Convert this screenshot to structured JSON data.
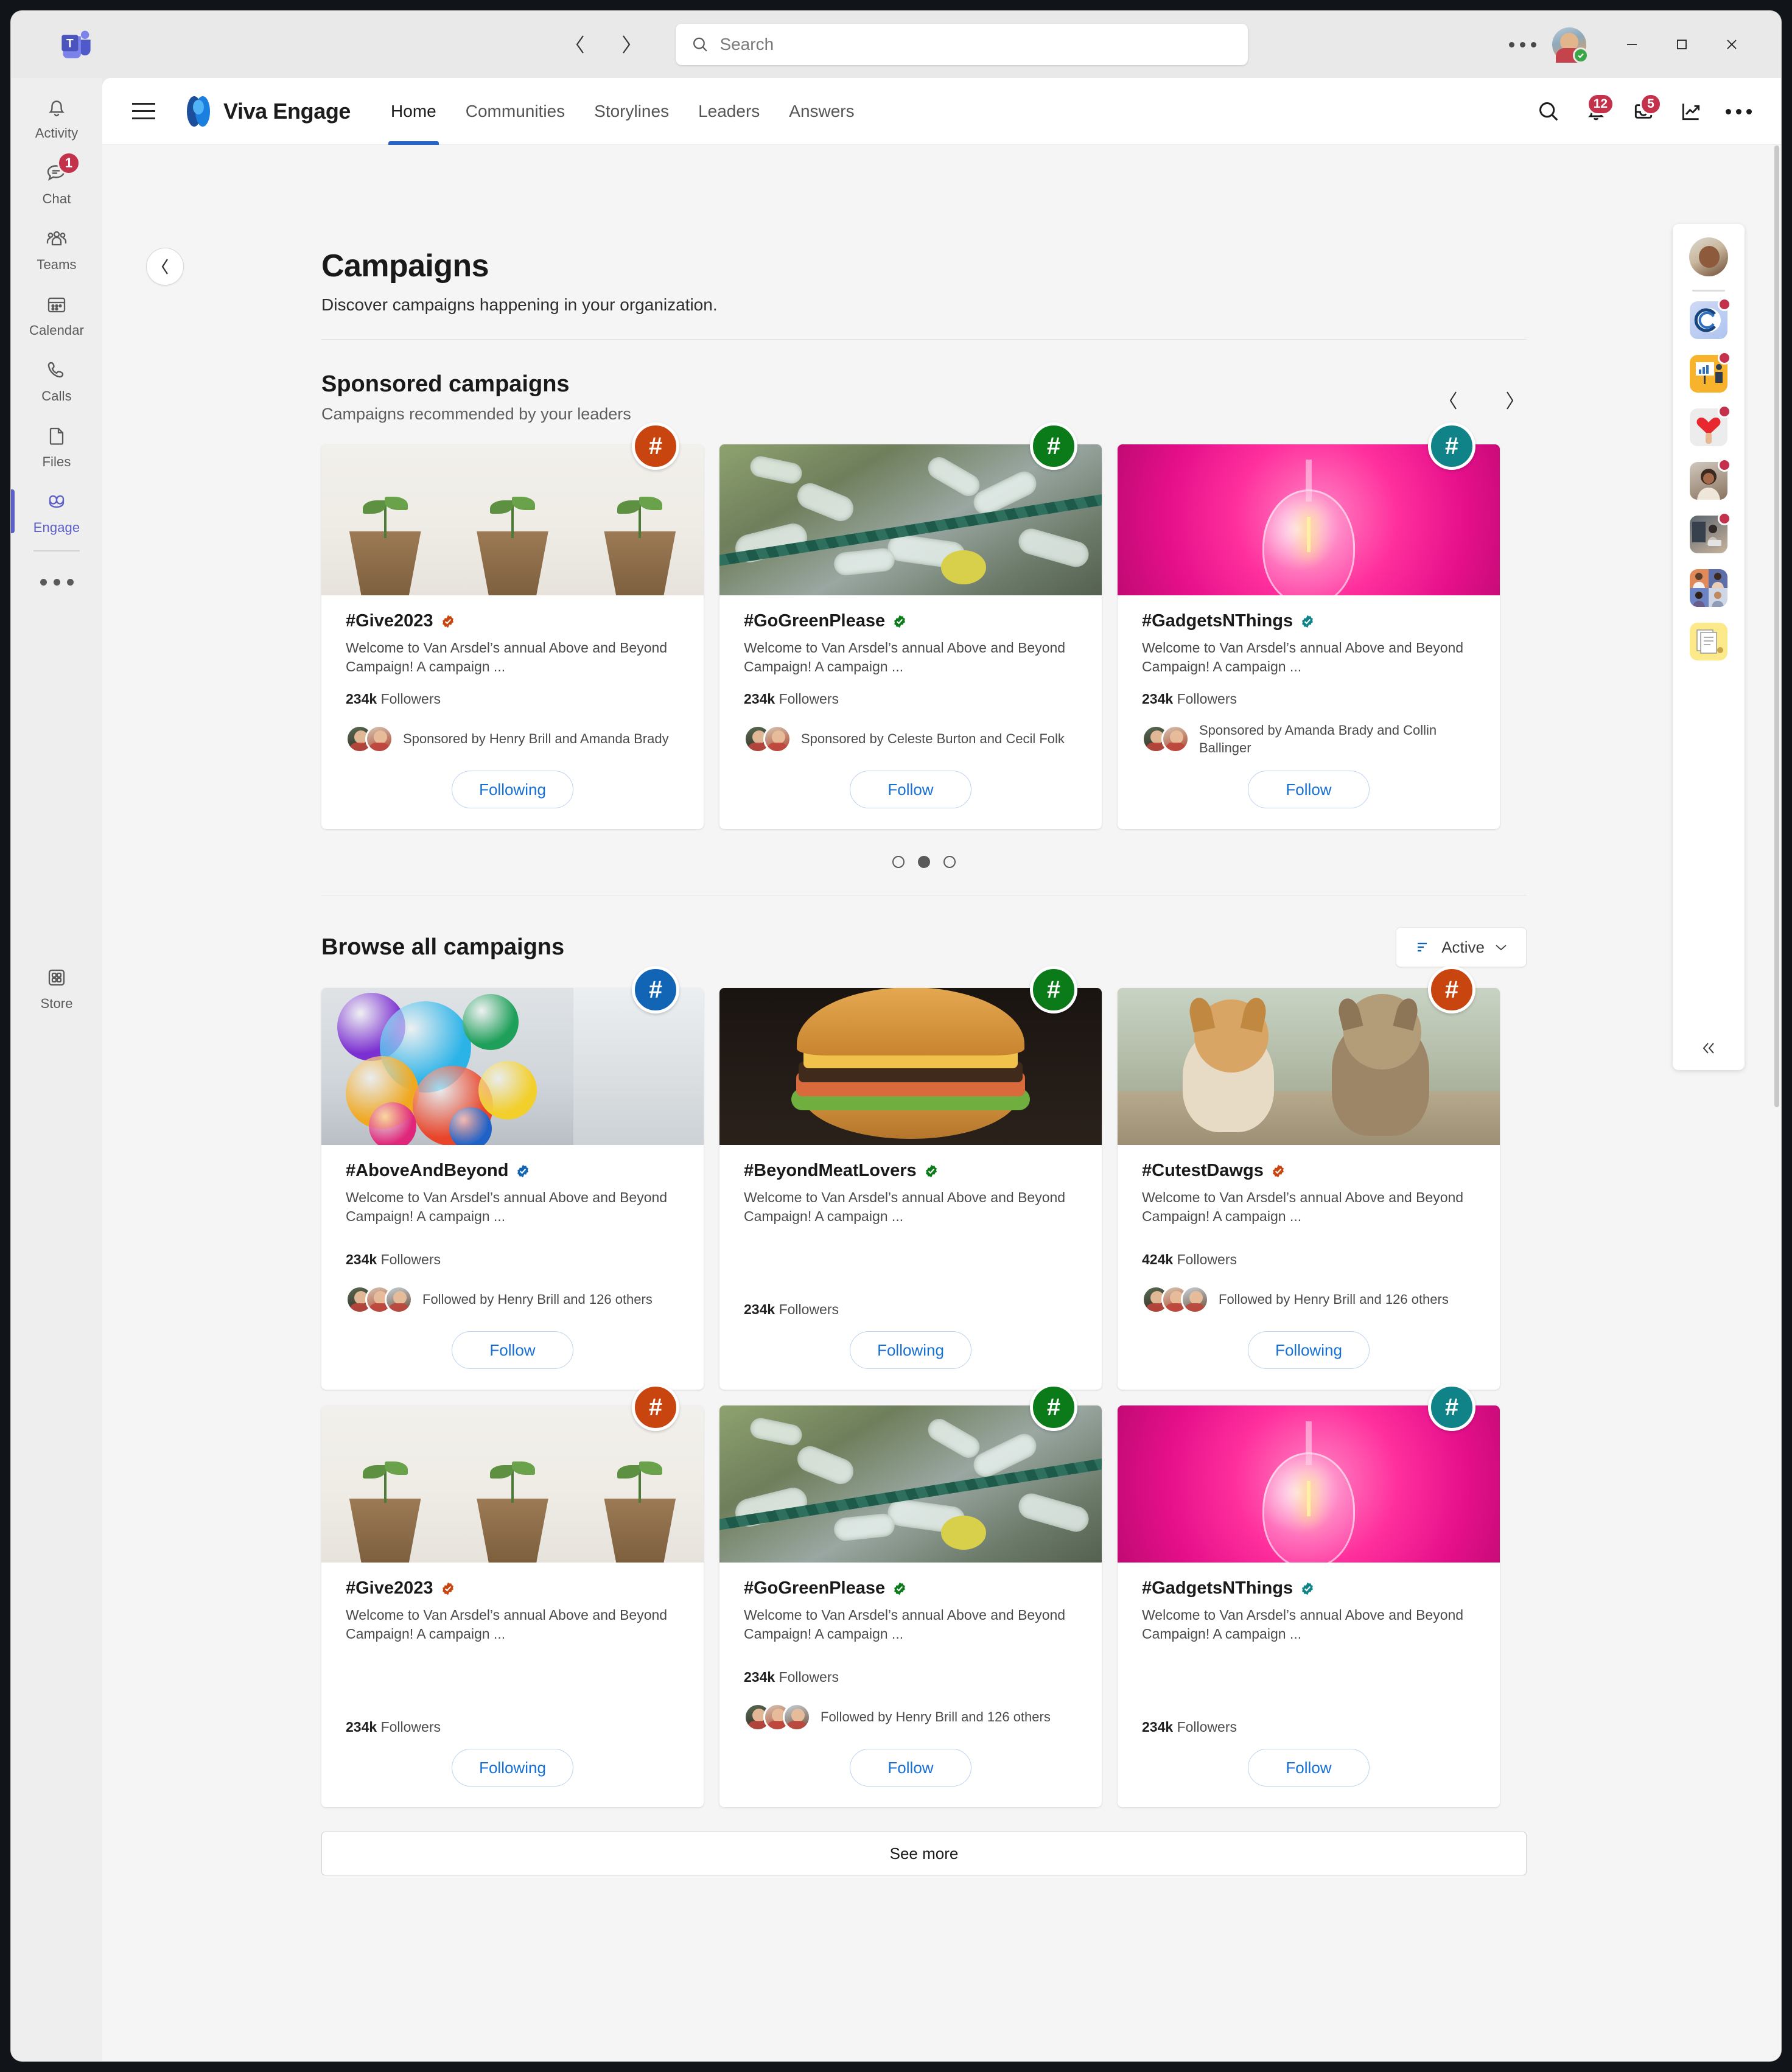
{
  "window": {
    "search_placeholder": "Search",
    "controls": {
      "more": "more-options",
      "minimize": "minimize",
      "maximize": "maximize",
      "close": "close"
    }
  },
  "rail": {
    "items": [
      {
        "label": "Activity",
        "icon": "bell-icon",
        "badge": null
      },
      {
        "label": "Chat",
        "icon": "chat-icon",
        "badge": "1"
      },
      {
        "label": "Teams",
        "icon": "teams-icon",
        "badge": null
      },
      {
        "label": "Calendar",
        "icon": "calendar-icon",
        "badge": null
      },
      {
        "label": "Calls",
        "icon": "phone-icon",
        "badge": null
      },
      {
        "label": "Files",
        "icon": "file-icon",
        "badge": null
      },
      {
        "label": "Engage",
        "icon": "engage-icon",
        "badge": null,
        "active": true
      }
    ],
    "more_label": "more-apps",
    "store": {
      "label": "Store",
      "icon": "store-icon"
    }
  },
  "header": {
    "brand": "Viva Engage",
    "nav": [
      {
        "label": "Home",
        "active": true
      },
      {
        "label": "Communities",
        "active": false
      },
      {
        "label": "Storylines",
        "active": false
      },
      {
        "label": "Leaders",
        "active": false
      },
      {
        "label": "Answers",
        "active": false
      }
    ],
    "icons": [
      {
        "name": "search-icon",
        "badge": null
      },
      {
        "name": "bell-icon",
        "badge": "12"
      },
      {
        "name": "inbox-icon",
        "badge": "5"
      },
      {
        "name": "analytics-icon",
        "badge": null
      },
      {
        "name": "more-icon",
        "badge": null
      }
    ]
  },
  "page": {
    "title": "Campaigns",
    "subtitle": "Discover campaigns happening in your organization."
  },
  "sponsored": {
    "title": "Sponsored campaigns",
    "subtitle": "Campaigns recommended by your leaders",
    "prev": "previous",
    "next": "next",
    "dots": [
      false,
      true,
      false
    ],
    "cards": [
      {
        "name": "#Give2023",
        "desc": "Welcome to Van Arsdel’s annual Above and Beyond Campaign! A campaign ...",
        "followers_count": "234k",
        "followers_label": "Followers",
        "people_text": "Sponsored by Henry Brill and Amanda Brady",
        "people_avatars": 2,
        "button": "Following",
        "accent": "#c9450f",
        "verified_color": "#c9450f",
        "image": "seedling-pots"
      },
      {
        "name": "#GoGreenPlease",
        "desc": "Welcome to Van Arsdel’s annual Above and Beyond Campaign! A campaign ...",
        "followers_count": "234k",
        "followers_label": "Followers",
        "people_text": "Sponsored by Celeste Burton and Cecil Folk",
        "people_avatars": 2,
        "button": "Follow",
        "accent": "#0b7a18",
        "verified_color": "#0b7a18",
        "image": "plastic-bottles"
      },
      {
        "name": "#GadgetsNThings",
        "desc": "Welcome to Van Arsdel’s annual Above and Beyond Campaign! A campaign ...",
        "followers_count": "234k",
        "followers_label": "Followers",
        "people_text": "Sponsored by Amanda Brady and Collin Ballinger",
        "people_avatars": 2,
        "button": "Follow",
        "accent": "#0f8387",
        "verified_color": "#0f8387",
        "image": "pink-bulb"
      }
    ]
  },
  "browse": {
    "title": "Browse all campaigns",
    "filter_label": "Active",
    "see_more": "See more",
    "cards": [
      {
        "name": "#AboveAndBeyond",
        "desc": "Welcome to Van Arsdel’s annual Above and Beyond Campaign! A campaign ...",
        "followers_count": "234k",
        "followers_label": "Followers",
        "people_text": "Followed by Henry Brill and 126 others",
        "people_avatars": 3,
        "button": "Follow",
        "accent": "#1264b5",
        "verified_color": "#1264b5",
        "image": "balloons"
      },
      {
        "name": "#BeyondMeatLovers",
        "desc": "Welcome to Van Arsdel’s annual Above and Beyond Campaign! A campaign ...",
        "followers_count": "234k",
        "followers_label": "Followers",
        "people_text": "",
        "people_avatars": 0,
        "button": "Following",
        "accent": "#0b7a18",
        "verified_color": "#0b7a18",
        "image": "burger"
      },
      {
        "name": "#CutestDawgs",
        "desc": "Welcome to Van Arsdel’s annual Above and Beyond Campaign! A campaign ...",
        "followers_count": "424k",
        "followers_label": "Followers",
        "people_text": "Followed by Henry Brill and 126 others",
        "people_avatars": 3,
        "button": "Following",
        "accent": "#c9450f",
        "verified_color": "#c9450f",
        "image": "dogs"
      },
      {
        "name": "#Give2023",
        "desc": "Welcome to Van Arsdel’s annual Above and Beyond Campaign! A campaign ...",
        "followers_count": "234k",
        "followers_label": "Followers",
        "people_text": "",
        "people_avatars": 0,
        "button": "Following",
        "accent": "#c9450f",
        "verified_color": "#c9450f",
        "image": "seedling-pots"
      },
      {
        "name": "#GoGreenPlease",
        "desc": "Welcome to Van Arsdel’s annual Above and Beyond Campaign! A campaign ...",
        "followers_count": "234k",
        "followers_label": "Followers",
        "people_text": "Followed by Henry Brill and 126 others",
        "people_avatars": 3,
        "button": "Follow",
        "accent": "#0b7a18",
        "verified_color": "#0b7a18",
        "image": "plastic-bottles"
      },
      {
        "name": "#GadgetsNThings",
        "desc": "Welcome to Van Arsdel’s annual Above and Beyond Campaign! A campaign ...",
        "followers_count": "234k",
        "followers_label": "Followers",
        "people_text": "",
        "people_avatars": 0,
        "button": "Follow",
        "accent": "#0f8387",
        "verified_color": "#0f8387",
        "image": "pink-bulb"
      }
    ]
  },
  "app_rail": {
    "items": [
      {
        "name": "copilot-app",
        "badge": true
      },
      {
        "name": "presentation-app",
        "badge": true
      },
      {
        "name": "heart-app",
        "badge": true
      },
      {
        "name": "person-app",
        "badge": true
      },
      {
        "name": "laptop-person-app",
        "badge": true
      },
      {
        "name": "people-grid-app",
        "badge": false
      },
      {
        "name": "documents-app",
        "badge": false
      }
    ],
    "collapse": "collapse-rail"
  }
}
